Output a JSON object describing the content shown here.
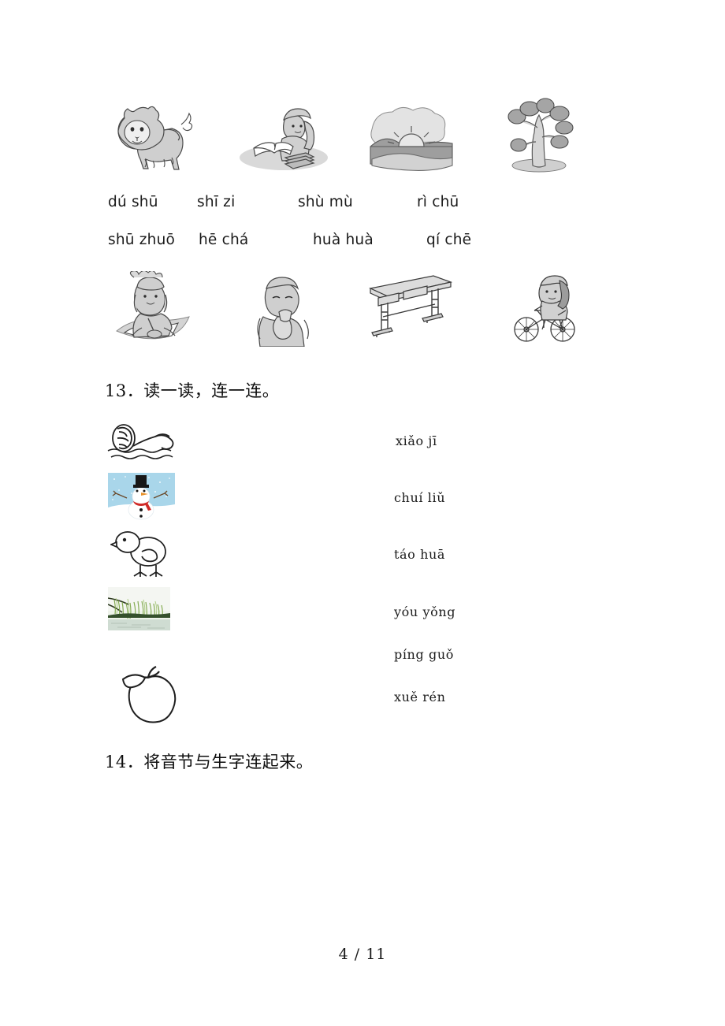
{
  "page": {
    "footer": "4 / 11",
    "background": "#ffffff"
  },
  "exercise_top": {
    "pictures_row1": [
      {
        "name": "lion",
        "pinyin_match": "shī zi"
      },
      {
        "name": "child-reading-at-desk",
        "pinyin_match": "dú shū"
      },
      {
        "name": "sunrise-over-hills",
        "pinyin_match": "rì chū"
      },
      {
        "name": "tree",
        "pinyin_match": "shù mù"
      }
    ],
    "word_row1": [
      {
        "text": "dú shū"
      },
      {
        "text": "shī zi"
      },
      {
        "text": "shù mù"
      },
      {
        "text": "rì chū"
      }
    ],
    "word_row2": [
      {
        "text": "shū zhuō"
      },
      {
        "text": "hē chá"
      },
      {
        "text": "huà huà"
      },
      {
        "text": "qí chē"
      }
    ],
    "pictures_row2": [
      {
        "name": "girl-drawing",
        "pinyin_match": "huà huà"
      },
      {
        "name": "boy-drinking-tea",
        "pinyin_match": "hē chá"
      },
      {
        "name": "school-desk",
        "pinyin_match": "shū zhuō"
      },
      {
        "name": "child-riding-bicycle",
        "pinyin_match": "qí chē"
      }
    ]
  },
  "question13": {
    "heading": "13．读一读，连一连。",
    "pictures": [
      {
        "name": "swimming-person",
        "kind": "line-art"
      },
      {
        "name": "snowman",
        "kind": "photo"
      },
      {
        "name": "chick",
        "kind": "line-art"
      },
      {
        "name": "willow-tree",
        "kind": "photo"
      },
      {
        "name": "apple",
        "kind": "line-art"
      }
    ],
    "pinyin_options": [
      {
        "text": "xiǎo  jī"
      },
      {
        "text": "chuí  liǔ"
      },
      {
        "text": "táo  huā"
      },
      {
        "text": "yóu  yǒng"
      },
      {
        "text": "píng  guǒ"
      },
      {
        "text": "xuě  rén"
      }
    ]
  },
  "question14": {
    "heading": "14．将音节与生字连起来。"
  },
  "colors": {
    "ink": "#1a1a1a",
    "illustration_gray": "#9a9a9a",
    "illustration_light": "#d5d5d5",
    "snow_sky": "#a9d6ea",
    "snow_white": "#ffffff",
    "hat_black": "#171717",
    "nose_orange": "#e8912a",
    "scarf_red": "#cf2b28",
    "willow_green": "#6f9e3f",
    "willow_water": "#35502c"
  }
}
